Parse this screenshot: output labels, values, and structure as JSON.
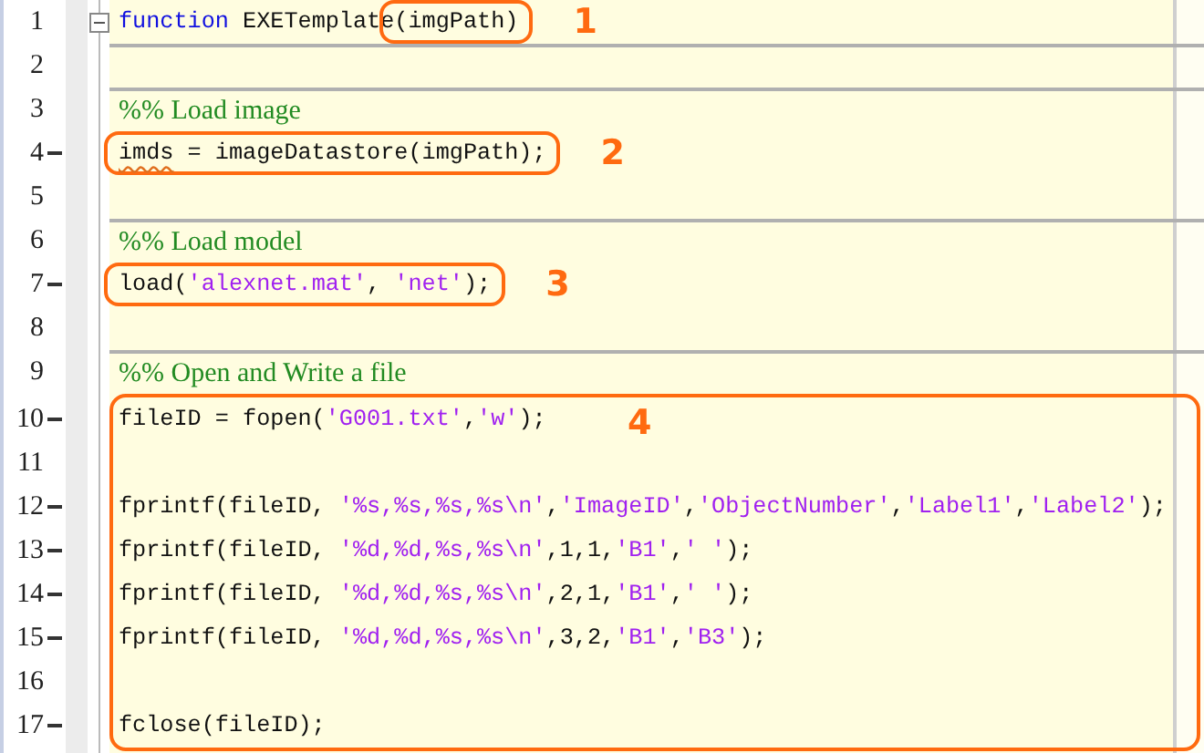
{
  "editor": {
    "blocks": [
      {
        "kind": "line",
        "number": "1",
        "executable": false,
        "foldable": true,
        "cell_start": false,
        "tokens": [
          {
            "kind": "keyword",
            "text": "function"
          },
          {
            "kind": "plain",
            "text": " EXETemplate"
          }
        ],
        "box": {
          "label": "1",
          "tokens": [
            {
              "kind": "plain",
              "text": "(imgPath)"
            }
          ]
        }
      },
      {
        "kind": "line",
        "number": "2",
        "executable": false,
        "foldable": false,
        "cell_start": true
      },
      {
        "kind": "line",
        "number": "3",
        "executable": false,
        "foldable": false,
        "cell_start": true,
        "tokens": [
          {
            "kind": "comment",
            "text": "%% Load image"
          }
        ]
      },
      {
        "kind": "line",
        "number": "4",
        "executable": true,
        "foldable": false,
        "cell_start": false,
        "box": {
          "label": "2",
          "tokens": [
            {
              "kind": "warning",
              "text": "imds"
            },
            {
              "kind": "plain",
              "text": " = imageDatastore(imgPath);"
            }
          ]
        }
      },
      {
        "kind": "line",
        "number": "5",
        "executable": false,
        "foldable": false,
        "cell_start": false
      },
      {
        "kind": "line",
        "number": "6",
        "executable": false,
        "foldable": false,
        "cell_start": true,
        "tokens": [
          {
            "kind": "comment",
            "text": "%% Load model"
          }
        ]
      },
      {
        "kind": "line",
        "number": "7",
        "executable": true,
        "foldable": false,
        "cell_start": false,
        "box": {
          "label": "3",
          "tokens": [
            {
              "kind": "plain",
              "text": "load("
            },
            {
              "kind": "string",
              "text": "'alexnet.mat'"
            },
            {
              "kind": "plain",
              "text": ", "
            },
            {
              "kind": "string",
              "text": "'net'"
            },
            {
              "kind": "plain",
              "text": ");"
            }
          ]
        }
      },
      {
        "kind": "line",
        "number": "8",
        "executable": false,
        "foldable": false,
        "cell_start": false
      },
      {
        "kind": "line",
        "number": "9",
        "executable": false,
        "foldable": false,
        "cell_start": true,
        "tokens": [
          {
            "kind": "comment",
            "text": "%% Open and Write a file"
          }
        ]
      },
      {
        "kind": "group",
        "label": "4",
        "lines": [
          {
            "number": "10",
            "executable": true,
            "foldable": false,
            "cell_start": false,
            "tokens": [
              {
                "kind": "plain",
                "text": "fileID = fopen("
              },
              {
                "kind": "string",
                "text": "'G001.txt'"
              },
              {
                "kind": "plain",
                "text": ","
              },
              {
                "kind": "string",
                "text": "'w'"
              },
              {
                "kind": "plain",
                "text": ");"
              }
            ]
          },
          {
            "number": "11",
            "executable": false,
            "foldable": false,
            "cell_start": false
          },
          {
            "number": "12",
            "executable": true,
            "foldable": false,
            "cell_start": false,
            "tokens": [
              {
                "kind": "plain",
                "text": "fprintf(fileID, "
              },
              {
                "kind": "string",
                "text": "'%s,%s,%s,%s\\n'"
              },
              {
                "kind": "plain",
                "text": ","
              },
              {
                "kind": "string",
                "text": "'ImageID'"
              },
              {
                "kind": "plain",
                "text": ","
              },
              {
                "kind": "string",
                "text": "'ObjectNumber'"
              },
              {
                "kind": "plain",
                "text": ","
              },
              {
                "kind": "string",
                "text": "'Label1'"
              },
              {
                "kind": "plain",
                "text": ","
              },
              {
                "kind": "string",
                "text": "'Label2'"
              },
              {
                "kind": "plain",
                "text": ");"
              }
            ]
          },
          {
            "number": "13",
            "executable": true,
            "foldable": false,
            "cell_start": false,
            "tokens": [
              {
                "kind": "plain",
                "text": "fprintf(fileID, "
              },
              {
                "kind": "string",
                "text": "'%d,%d,%s,%s\\n'"
              },
              {
                "kind": "plain",
                "text": ",1,1,"
              },
              {
                "kind": "string",
                "text": "'B1'"
              },
              {
                "kind": "plain",
                "text": ","
              },
              {
                "kind": "string",
                "text": "' '"
              },
              {
                "kind": "plain",
                "text": ");"
              }
            ]
          },
          {
            "number": "14",
            "executable": true,
            "foldable": false,
            "cell_start": false,
            "tokens": [
              {
                "kind": "plain",
                "text": "fprintf(fileID, "
              },
              {
                "kind": "string",
                "text": "'%d,%d,%s,%s\\n'"
              },
              {
                "kind": "plain",
                "text": ",2,1,"
              },
              {
                "kind": "string",
                "text": "'B1'"
              },
              {
                "kind": "plain",
                "text": ","
              },
              {
                "kind": "string",
                "text": "' '"
              },
              {
                "kind": "plain",
                "text": ");"
              }
            ]
          },
          {
            "number": "15",
            "executable": true,
            "foldable": false,
            "cell_start": false,
            "tokens": [
              {
                "kind": "plain",
                "text": "fprintf(fileID, "
              },
              {
                "kind": "string",
                "text": "'%d,%d,%s,%s\\n'"
              },
              {
                "kind": "plain",
                "text": ",3,2,"
              },
              {
                "kind": "string",
                "text": "'B1'"
              },
              {
                "kind": "plain",
                "text": ","
              },
              {
                "kind": "string",
                "text": "'B3'"
              },
              {
                "kind": "plain",
                "text": ");"
              }
            ]
          },
          {
            "number": "16",
            "executable": false,
            "foldable": false,
            "cell_start": false
          },
          {
            "number": "17",
            "executable": true,
            "foldable": false,
            "cell_start": false,
            "tokens": [
              {
                "kind": "plain",
                "text": "fclose(fileID);"
              }
            ]
          }
        ]
      }
    ]
  }
}
